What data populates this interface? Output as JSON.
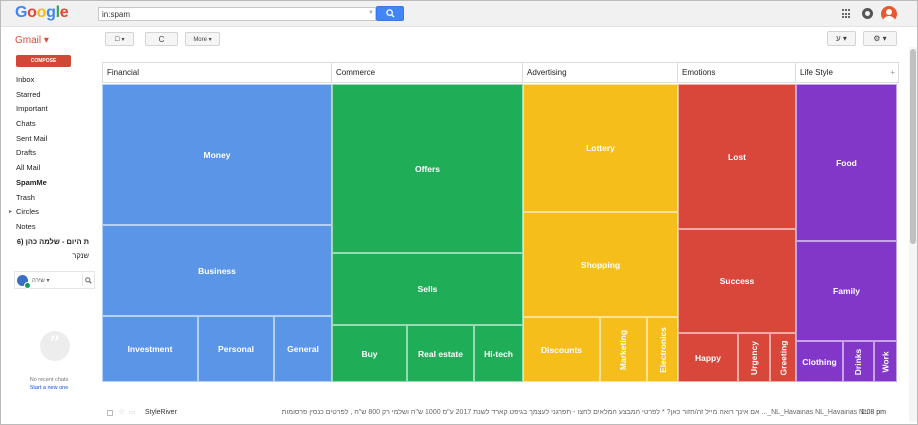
{
  "header": {
    "logo_letters": [
      {
        "ch": "G",
        "color": "#4285f4"
      },
      {
        "ch": "o",
        "color": "#ea4335"
      },
      {
        "ch": "o",
        "color": "#fbbc05"
      },
      {
        "ch": "g",
        "color": "#4285f4"
      },
      {
        "ch": "l",
        "color": "#34a853"
      },
      {
        "ch": "e",
        "color": "#ea4335"
      }
    ],
    "search_value": "in:spam",
    "icons": [
      "apps-icon",
      "notifications-icon",
      "account-avatar"
    ]
  },
  "toolbar": {
    "gmail_label": "Gmail ▾",
    "select_label": "☐ ▾",
    "refresh_label": "C",
    "more_label": "More ▾",
    "input_tools_label": "ע ▾",
    "settings_label": "⚙ ▾"
  },
  "sidebar": {
    "compose_label": "COMPOSE",
    "items": [
      {
        "label": "Inbox",
        "bold": false
      },
      {
        "label": "Starred",
        "bold": false
      },
      {
        "label": "Important",
        "bold": false
      },
      {
        "label": "Chats",
        "bold": false
      },
      {
        "label": "Sent Mail",
        "bold": false
      },
      {
        "label": "Drafts",
        "bold": false
      },
      {
        "label": "All Mail",
        "bold": false
      },
      {
        "label": "SpamMe",
        "bold": true
      },
      {
        "label": "Trash",
        "bold": false
      },
      {
        "label": "Circles",
        "bold": false
      },
      {
        "label": "Notes",
        "bold": false
      }
    ],
    "rtl_item_1": "ת היום - שלמה כהן (6",
    "rtl_item_2": "שנקר",
    "hangout_user": "שירה ▾",
    "no_recent_chats": "No recent chats",
    "start_new": "Start a new one"
  },
  "treemap": {
    "categories": [
      {
        "name": "Financial",
        "color": "#5b95e8"
      },
      {
        "name": "Commerce",
        "color": "#1fae57"
      },
      {
        "name": "Advertising",
        "color": "#f6be1b"
      },
      {
        "name": "Emotions",
        "color": "#d9463a"
      },
      {
        "name": "Life Style",
        "color": "#8237c9"
      }
    ],
    "labels": {
      "money": "Money",
      "business": "Business",
      "investment": "Investment",
      "personal": "Personal",
      "general": "General",
      "offers": "Offers",
      "sells": "Sells",
      "buy": "Buy",
      "real_estate": "Real estate",
      "hi_tech": "Hi-tech",
      "lottery": "Lottery",
      "shopping": "Shopping",
      "discounts": "Discounts",
      "marketing": "Marketing",
      "electronics": "Electronics",
      "lost": "Lost",
      "success": "Success",
      "happy": "Happy",
      "urgency": "Urgency",
      "greeting": "Greeting",
      "food": "Food",
      "family": "Family",
      "clothing": "Clothing",
      "drinks": "Drinks",
      "work": "Work"
    }
  },
  "email": {
    "sender": "StyleRiver",
    "snippet": "NL_Havainas NL_Havainas NL_... אם אינך רואה מייל זה/חזור כאן? * לפרטי המבצע המלאים לחצו - תפרגני לעצמך בגיפט קארד לשנת 2017 ע\"ס 1000 ש\"ח ושלמי רק 800 ש\"ח , לפרטים כנסין פרסומות",
    "time": "1:08 pm"
  }
}
